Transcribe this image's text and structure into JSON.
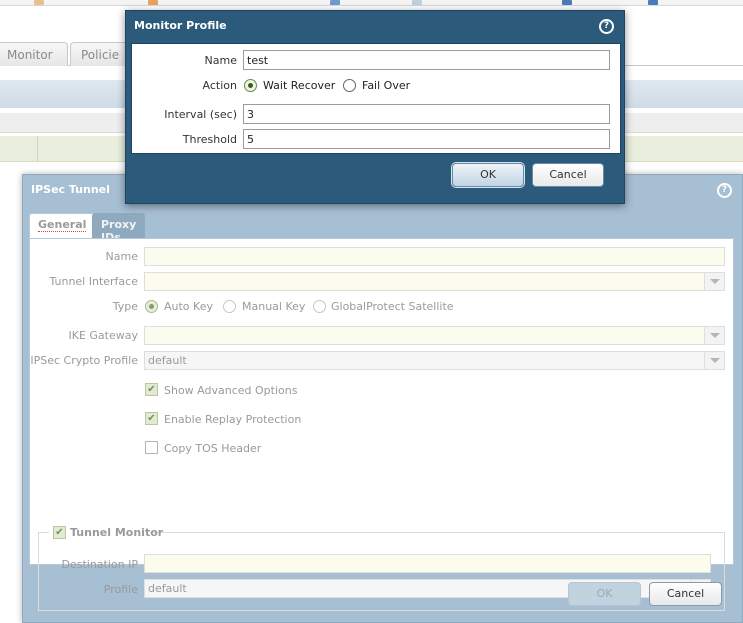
{
  "background": {
    "tabs": [
      {
        "label": "Monitor"
      },
      {
        "label": "Policie"
      }
    ]
  },
  "ipsec_dialog": {
    "title": "IPSec Tunnel",
    "tabs": [
      {
        "label": "General",
        "active": true
      },
      {
        "label": "Proxy IDs",
        "active": false
      }
    ],
    "fields": {
      "name": {
        "label": "Name",
        "value": ""
      },
      "tunnel_interface": {
        "label": "Tunnel Interface",
        "value": ""
      },
      "type": {
        "label": "Type",
        "options": [
          "Auto Key",
          "Manual Key",
          "GlobalProtect Satellite"
        ],
        "selected": "Auto Key"
      },
      "ike_gateway": {
        "label": "IKE Gateway",
        "value": ""
      },
      "ipsec_crypto_profile": {
        "label": "IPSec Crypto Profile",
        "value": "default"
      },
      "show_advanced": {
        "label": "Show Advanced Options",
        "checked": true
      },
      "replay_protection": {
        "label": "Enable Replay Protection",
        "checked": true
      },
      "copy_tos": {
        "label": "Copy TOS Header",
        "checked": false
      }
    },
    "tunnel_monitor": {
      "label": "Tunnel Monitor",
      "checked": true,
      "destination_ip": {
        "label": "Destination IP",
        "value": ""
      },
      "profile": {
        "label": "Profile",
        "value": "default"
      }
    },
    "buttons": {
      "ok": "OK",
      "cancel": "Cancel"
    }
  },
  "monitor_dialog": {
    "title": "Monitor Profile",
    "name": {
      "label": "Name",
      "value": "test"
    },
    "action": {
      "label": "Action",
      "options": [
        "Wait Recover",
        "Fail Over"
      ],
      "selected": "Wait Recover"
    },
    "interval": {
      "label": "Interval (sec)",
      "value": "3"
    },
    "threshold": {
      "label": "Threshold",
      "value": "5"
    },
    "buttons": {
      "ok": "OK",
      "cancel": "Cancel"
    }
  },
  "colors": {
    "monitor_titlebar": "#2b5a7b",
    "ipsec_titlebar": "#a7bfd2",
    "field_background": "#fbfbee"
  }
}
